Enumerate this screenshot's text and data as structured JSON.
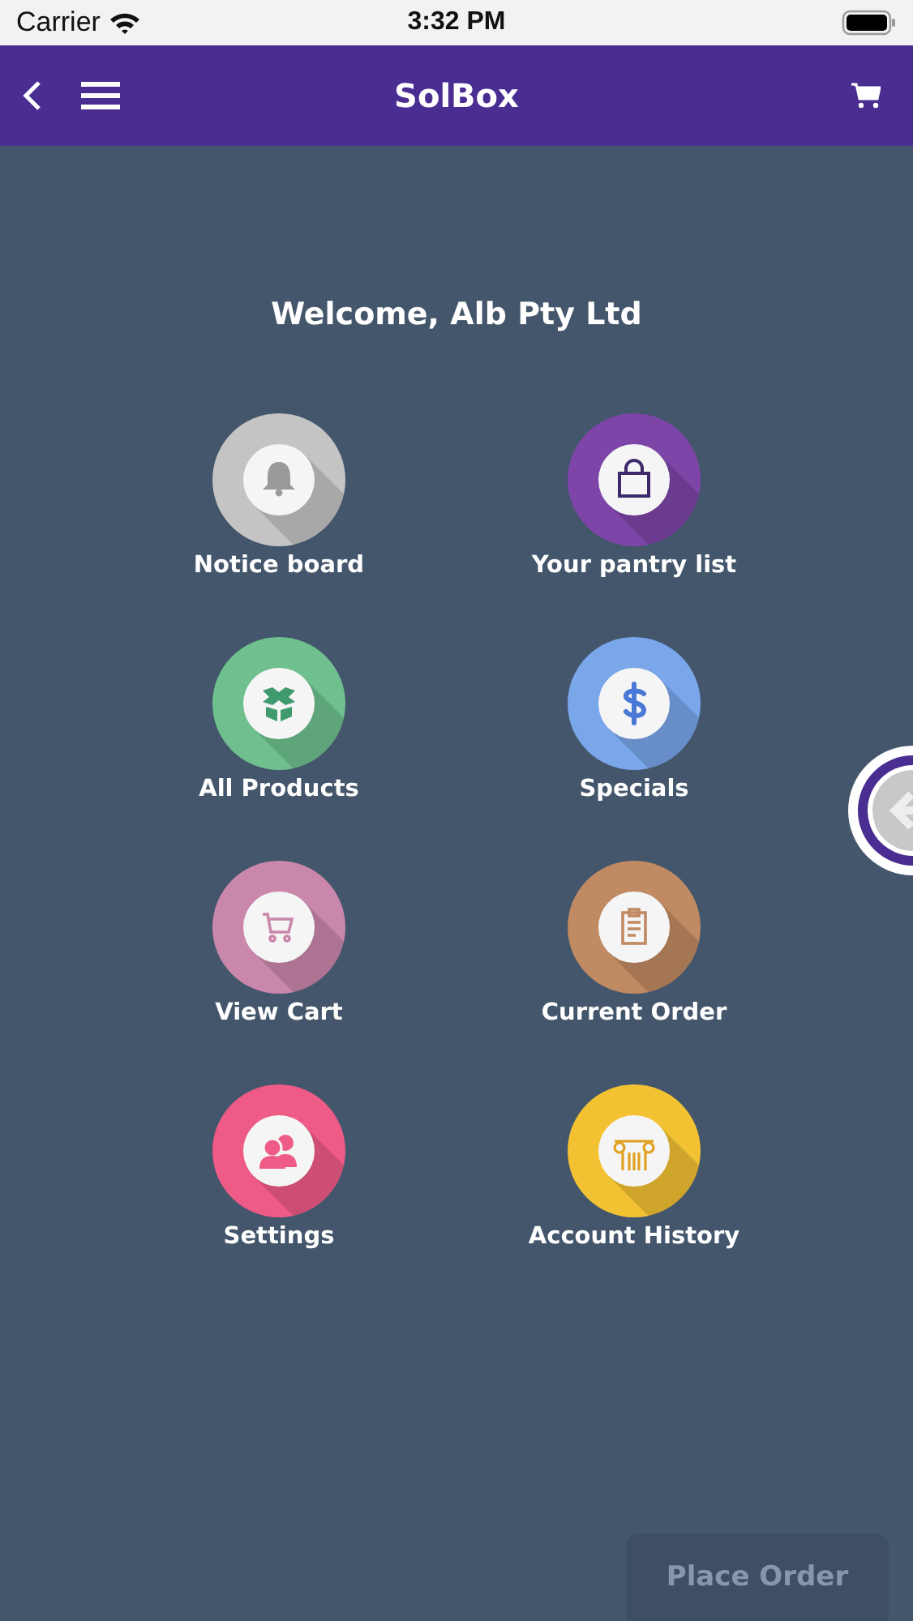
{
  "status_bar": {
    "carrier": "Carrier",
    "time": "3:32 PM"
  },
  "header": {
    "title": "SolBox"
  },
  "welcome": "Welcome, Alb Pty Ltd",
  "menu": [
    {
      "label": "Notice board",
      "color": "#c4c4c4"
    },
    {
      "label": "Your pantry list",
      "color": "#7d45a8"
    },
    {
      "label": "All Products",
      "color": "#6fc08e"
    },
    {
      "label": "Specials",
      "color": "#7aa6ea"
    },
    {
      "label": "View Cart",
      "color": "#c987ab"
    },
    {
      "label": "Current Order",
      "color": "#c08a62"
    },
    {
      "label": "Settings",
      "color": "#ee5b86"
    },
    {
      "label": "Account History",
      "color": "#f2c233"
    }
  ],
  "footer_button": "Place Order"
}
